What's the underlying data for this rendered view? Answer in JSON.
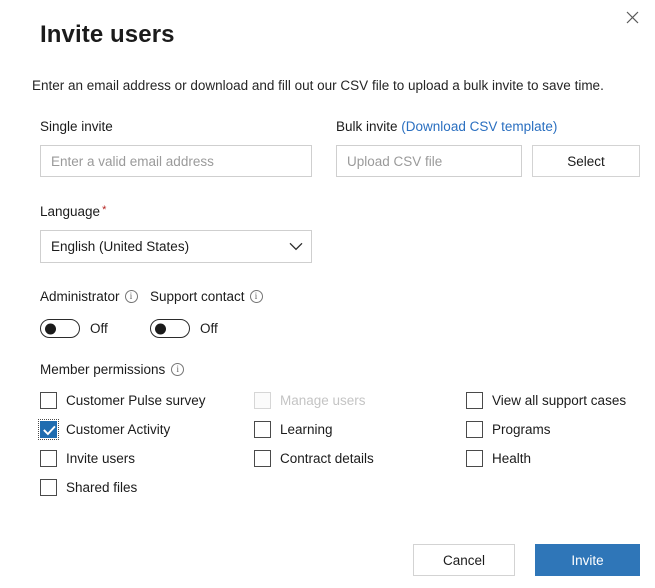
{
  "dialog": {
    "title": "Invite users",
    "close_label": "Close",
    "intro": "Enter an email address or download and fill out our CSV file to upload a bulk invite to save time."
  },
  "single_invite": {
    "label": "Single invite",
    "placeholder": "Enter a valid email address",
    "value": ""
  },
  "bulk_invite": {
    "label": "Bulk invite",
    "link_text": "(Download CSV template)",
    "placeholder": "Upload CSV file",
    "value": "",
    "select_button": "Select"
  },
  "language": {
    "label": "Language",
    "required_marker": "*",
    "value": "English (United States)"
  },
  "toggles": [
    {
      "label": "Administrator",
      "state_text": "Off",
      "checked": false,
      "info": "i"
    },
    {
      "label": "Support contact",
      "state_text": "Off",
      "checked": false,
      "info": "i"
    }
  ],
  "member_permissions": {
    "label": "Member permissions",
    "info": "i",
    "columns": [
      [
        {
          "label": "Customer Pulse survey",
          "checked": false,
          "disabled": false,
          "focused": false
        },
        {
          "label": "Customer Activity",
          "checked": true,
          "disabled": false,
          "focused": true
        },
        {
          "label": "Invite users",
          "checked": false,
          "disabled": false,
          "focused": false
        },
        {
          "label": "Shared files",
          "checked": false,
          "disabled": false,
          "focused": false
        }
      ],
      [
        {
          "label": "Manage users",
          "checked": false,
          "disabled": true,
          "focused": false
        },
        {
          "label": "Learning",
          "checked": false,
          "disabled": false,
          "focused": false
        },
        {
          "label": "Contract details",
          "checked": false,
          "disabled": false,
          "focused": false
        }
      ],
      [
        {
          "label": "View all support cases",
          "checked": false,
          "disabled": false,
          "focused": false
        },
        {
          "label": "Programs",
          "checked": false,
          "disabled": false,
          "focused": false
        },
        {
          "label": "Health",
          "checked": false,
          "disabled": false,
          "focused": false
        }
      ]
    ]
  },
  "footer": {
    "cancel_label": "Cancel",
    "invite_label": "Invite"
  },
  "colors": {
    "primary": "#2f76b8",
    "link": "#2a6fc0",
    "checkbox_checked": "#1f6cb0",
    "required": "#b4221f",
    "border": "#cfcfcf"
  }
}
